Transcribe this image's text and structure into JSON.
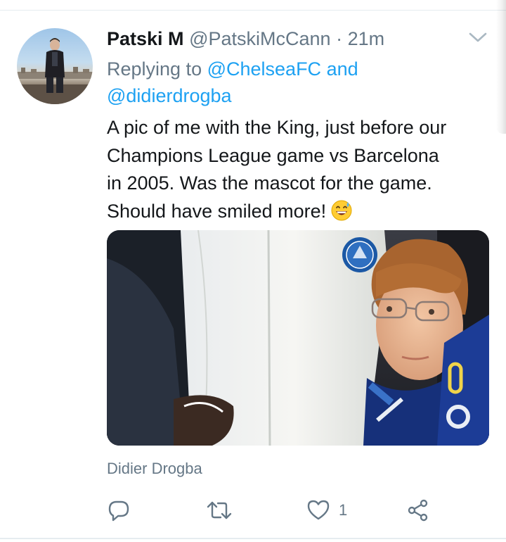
{
  "tweet": {
    "display_name": "Patski M",
    "handle": "@PatskiMcCann",
    "separator": " · ",
    "time": "21m",
    "reply": {
      "prefix": "Replying to ",
      "mention1": "@ChelseaFC",
      "joiner": " and",
      "mention2": "@didierdrogba"
    },
    "text_lines": [
      "A pic of me with the King, just before our",
      "Champions League game vs Barcelona",
      "in 2005. Was the mascot for the game.",
      "Should have smiled more!"
    ],
    "emoji": "grinning-face-with-sweat",
    "tagged_user": "Didier Drogba"
  },
  "actions": {
    "reply_icon": "reply-icon",
    "retweet_icon": "retweet-icon",
    "like_icon": "heart-icon",
    "like_count": "1",
    "share_icon": "share-icon"
  },
  "colors": {
    "text_primary": "#14171a",
    "text_secondary": "#657786",
    "link": "#1da1f2",
    "divider": "#e6ecf0"
  }
}
